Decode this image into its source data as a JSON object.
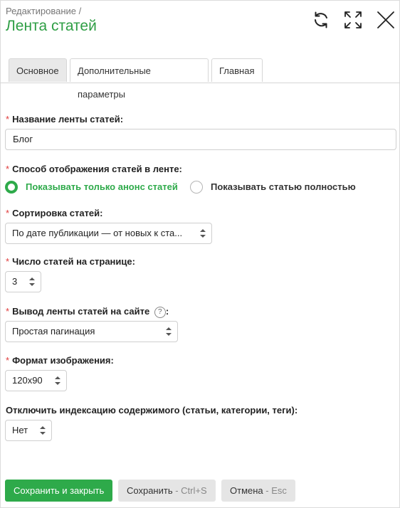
{
  "header": {
    "breadcrumb": "Редактирование /",
    "title": "Лента статей",
    "icons": [
      "refresh-icon",
      "expand-icon",
      "close-icon"
    ]
  },
  "tabs": [
    {
      "label": "Основное",
      "active": true
    },
    {
      "label": "Дополнительные параметры",
      "active": false
    },
    {
      "label": "Главная",
      "active": false
    }
  ],
  "form": {
    "name": {
      "label": "Название ленты статей:",
      "value": "Блог"
    },
    "display_mode": {
      "label": "Способ отображения статей в ленте:",
      "options": [
        {
          "label": "Показывать только анонс статей",
          "selected": true
        },
        {
          "label": "Показывать статью полностью",
          "selected": false
        }
      ]
    },
    "sort": {
      "label": "Сортировка статей:",
      "value": "По дате публикации — от новых к ста..."
    },
    "per_page": {
      "label": "Число статей на странице:",
      "value": "3"
    },
    "output": {
      "label": "Вывод ленты статей на сайте",
      "suffix": ":",
      "value": "Простая пагинация"
    },
    "image_format": {
      "label": "Формат изображения:",
      "value": "120x90"
    },
    "noindex": {
      "label": "Отключить индексацию содержимого (статьи, категории, теги):",
      "value": "Нет"
    }
  },
  "buttons": {
    "save_close": "Сохранить и закрыть",
    "save": "Сохранить",
    "save_hint": " - Ctrl+S",
    "cancel": "Отмена",
    "cancel_hint": " - Esc"
  },
  "colors": {
    "accent": "#2eaa4a",
    "title": "#2e9e44",
    "required": "#e03a3a"
  }
}
